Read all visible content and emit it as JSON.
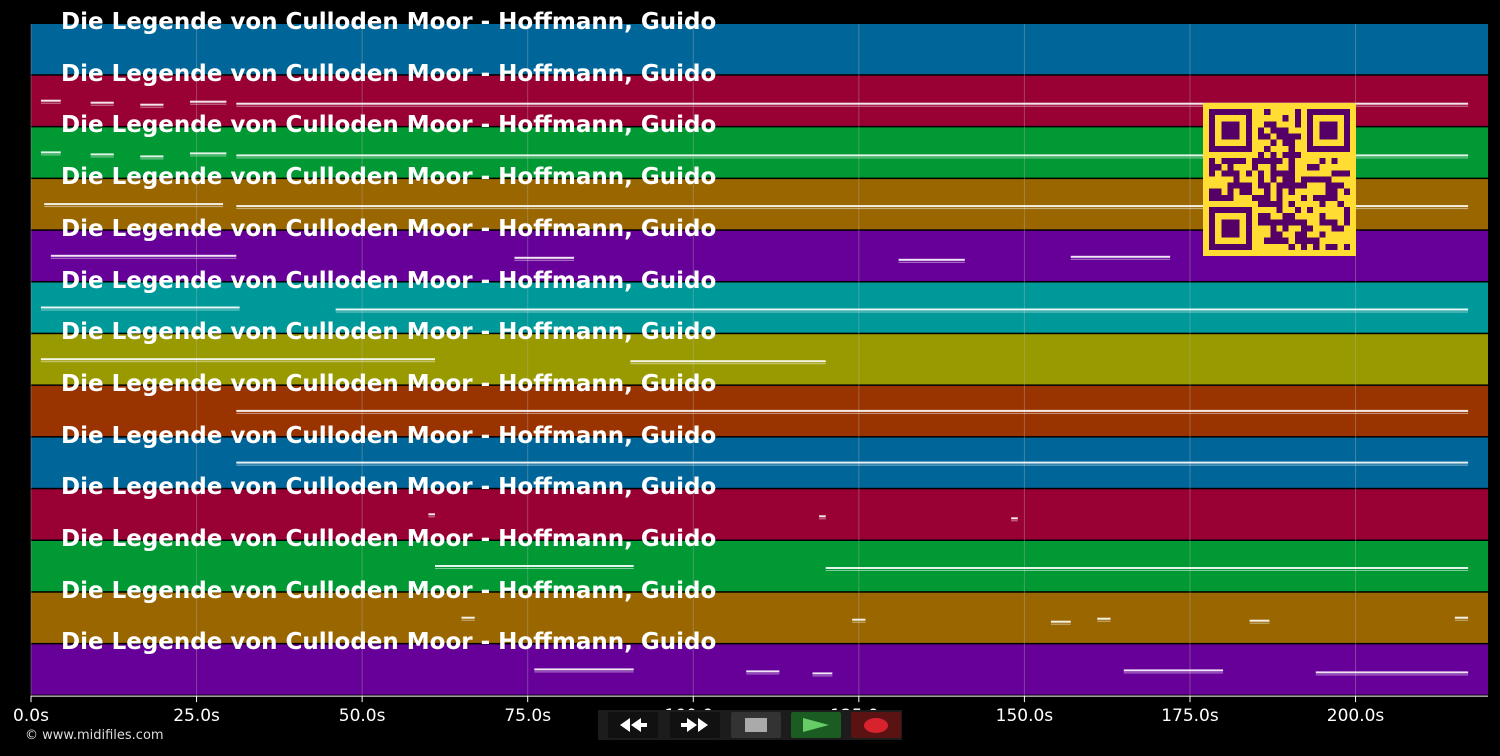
{
  "video": {
    "title_text": "Die Legende von Culloden Moor - Hoffmann, Guido",
    "copyright": "© www.midifiles.com"
  },
  "colors": {
    "tracks": [
      "#006699",
      "#990033",
      "#009933",
      "#996600",
      "#660099",
      "#009999",
      "#999900",
      "#993300",
      "#006699",
      "#990033",
      "#009933",
      "#996600",
      "#660099"
    ],
    "qr_fg": "#ffdd33",
    "qr_bg": "#550066",
    "grid": "#bbbbbb"
  },
  "time_axis": {
    "unit": "s",
    "range": [
      0,
      220
    ],
    "ticks": [
      0,
      25,
      50,
      75,
      100,
      125,
      150,
      175,
      200
    ],
    "tick_labels": [
      "0.0s",
      "25.0s",
      "50.0s",
      "75.0s",
      "100.0s",
      "125.0s",
      "150.0s",
      "175.0s",
      "200.0s"
    ]
  },
  "tracks": [
    {
      "notes": []
    },
    {
      "notes": [
        [
          1.5,
          4.5
        ],
        [
          9,
          12.5
        ],
        [
          16.5,
          20
        ],
        [
          24,
          29.5
        ],
        [
          31,
          217
        ]
      ]
    },
    {
      "notes": [
        [
          1.5,
          4.5
        ],
        [
          9,
          12.5
        ],
        [
          16.5,
          20
        ],
        [
          24,
          29.5
        ],
        [
          31,
          217
        ]
      ]
    },
    {
      "notes": [
        [
          2,
          29
        ],
        [
          31,
          217
        ]
      ]
    },
    {
      "notes": [
        [
          3,
          31
        ],
        [
          73,
          82
        ],
        [
          131,
          141
        ],
        [
          157,
          172
        ]
      ]
    },
    {
      "notes": [
        [
          1.5,
          31.5
        ],
        [
          46,
          217
        ]
      ]
    },
    {
      "notes": [
        [
          1.5,
          61
        ],
        [
          90.5,
          120
        ]
      ]
    },
    {
      "notes": [
        [
          31,
          217
        ]
      ]
    },
    {
      "notes": [
        [
          31,
          217
        ]
      ]
    },
    {
      "notes": [
        [
          60,
          61
        ],
        [
          119,
          120
        ],
        [
          148,
          149
        ]
      ]
    },
    {
      "notes": [
        [
          61,
          91
        ],
        [
          120,
          217
        ]
      ]
    },
    {
      "notes": [
        [
          65,
          67
        ],
        [
          124,
          126
        ],
        [
          154,
          157
        ],
        [
          161,
          163
        ],
        [
          184,
          187
        ],
        [
          215,
          217
        ]
      ]
    },
    {
      "notes": [
        [
          76,
          91
        ],
        [
          108,
          113
        ],
        [
          118,
          121
        ],
        [
          165,
          180
        ],
        [
          194,
          217
        ]
      ]
    }
  ],
  "controls": {
    "rewind_icon": "rewind-icon",
    "ffwd_icon": "fast-forward-icon",
    "stop_icon": "stop-icon",
    "play_icon": "play-icon",
    "record_icon": "record-icon"
  }
}
